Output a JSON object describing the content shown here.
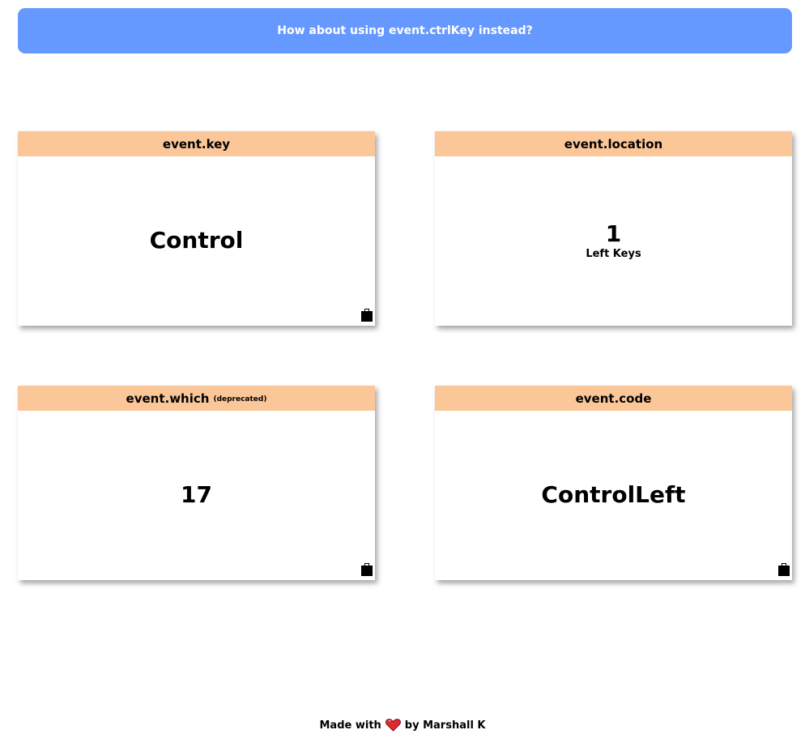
{
  "banner": {
    "text": "How about using event.ctrlKey instead?"
  },
  "cards": {
    "key": {
      "title": "event.key",
      "value": "Control"
    },
    "location": {
      "title": "event.location",
      "value": "1",
      "desc": "Left Keys"
    },
    "which": {
      "title": "event.which",
      "subtitle": "(deprecated)",
      "value": "17"
    },
    "code": {
      "title": "event.code",
      "value": "ControlLeft"
    }
  },
  "footer": {
    "made_with": "Made with",
    "by": "by Marshall K",
    "heart_icon": "heart-icon"
  },
  "colors": {
    "banner_bg": "#6699ff",
    "card_header_bg": "#fbc799",
    "heart": "#e0282e"
  }
}
